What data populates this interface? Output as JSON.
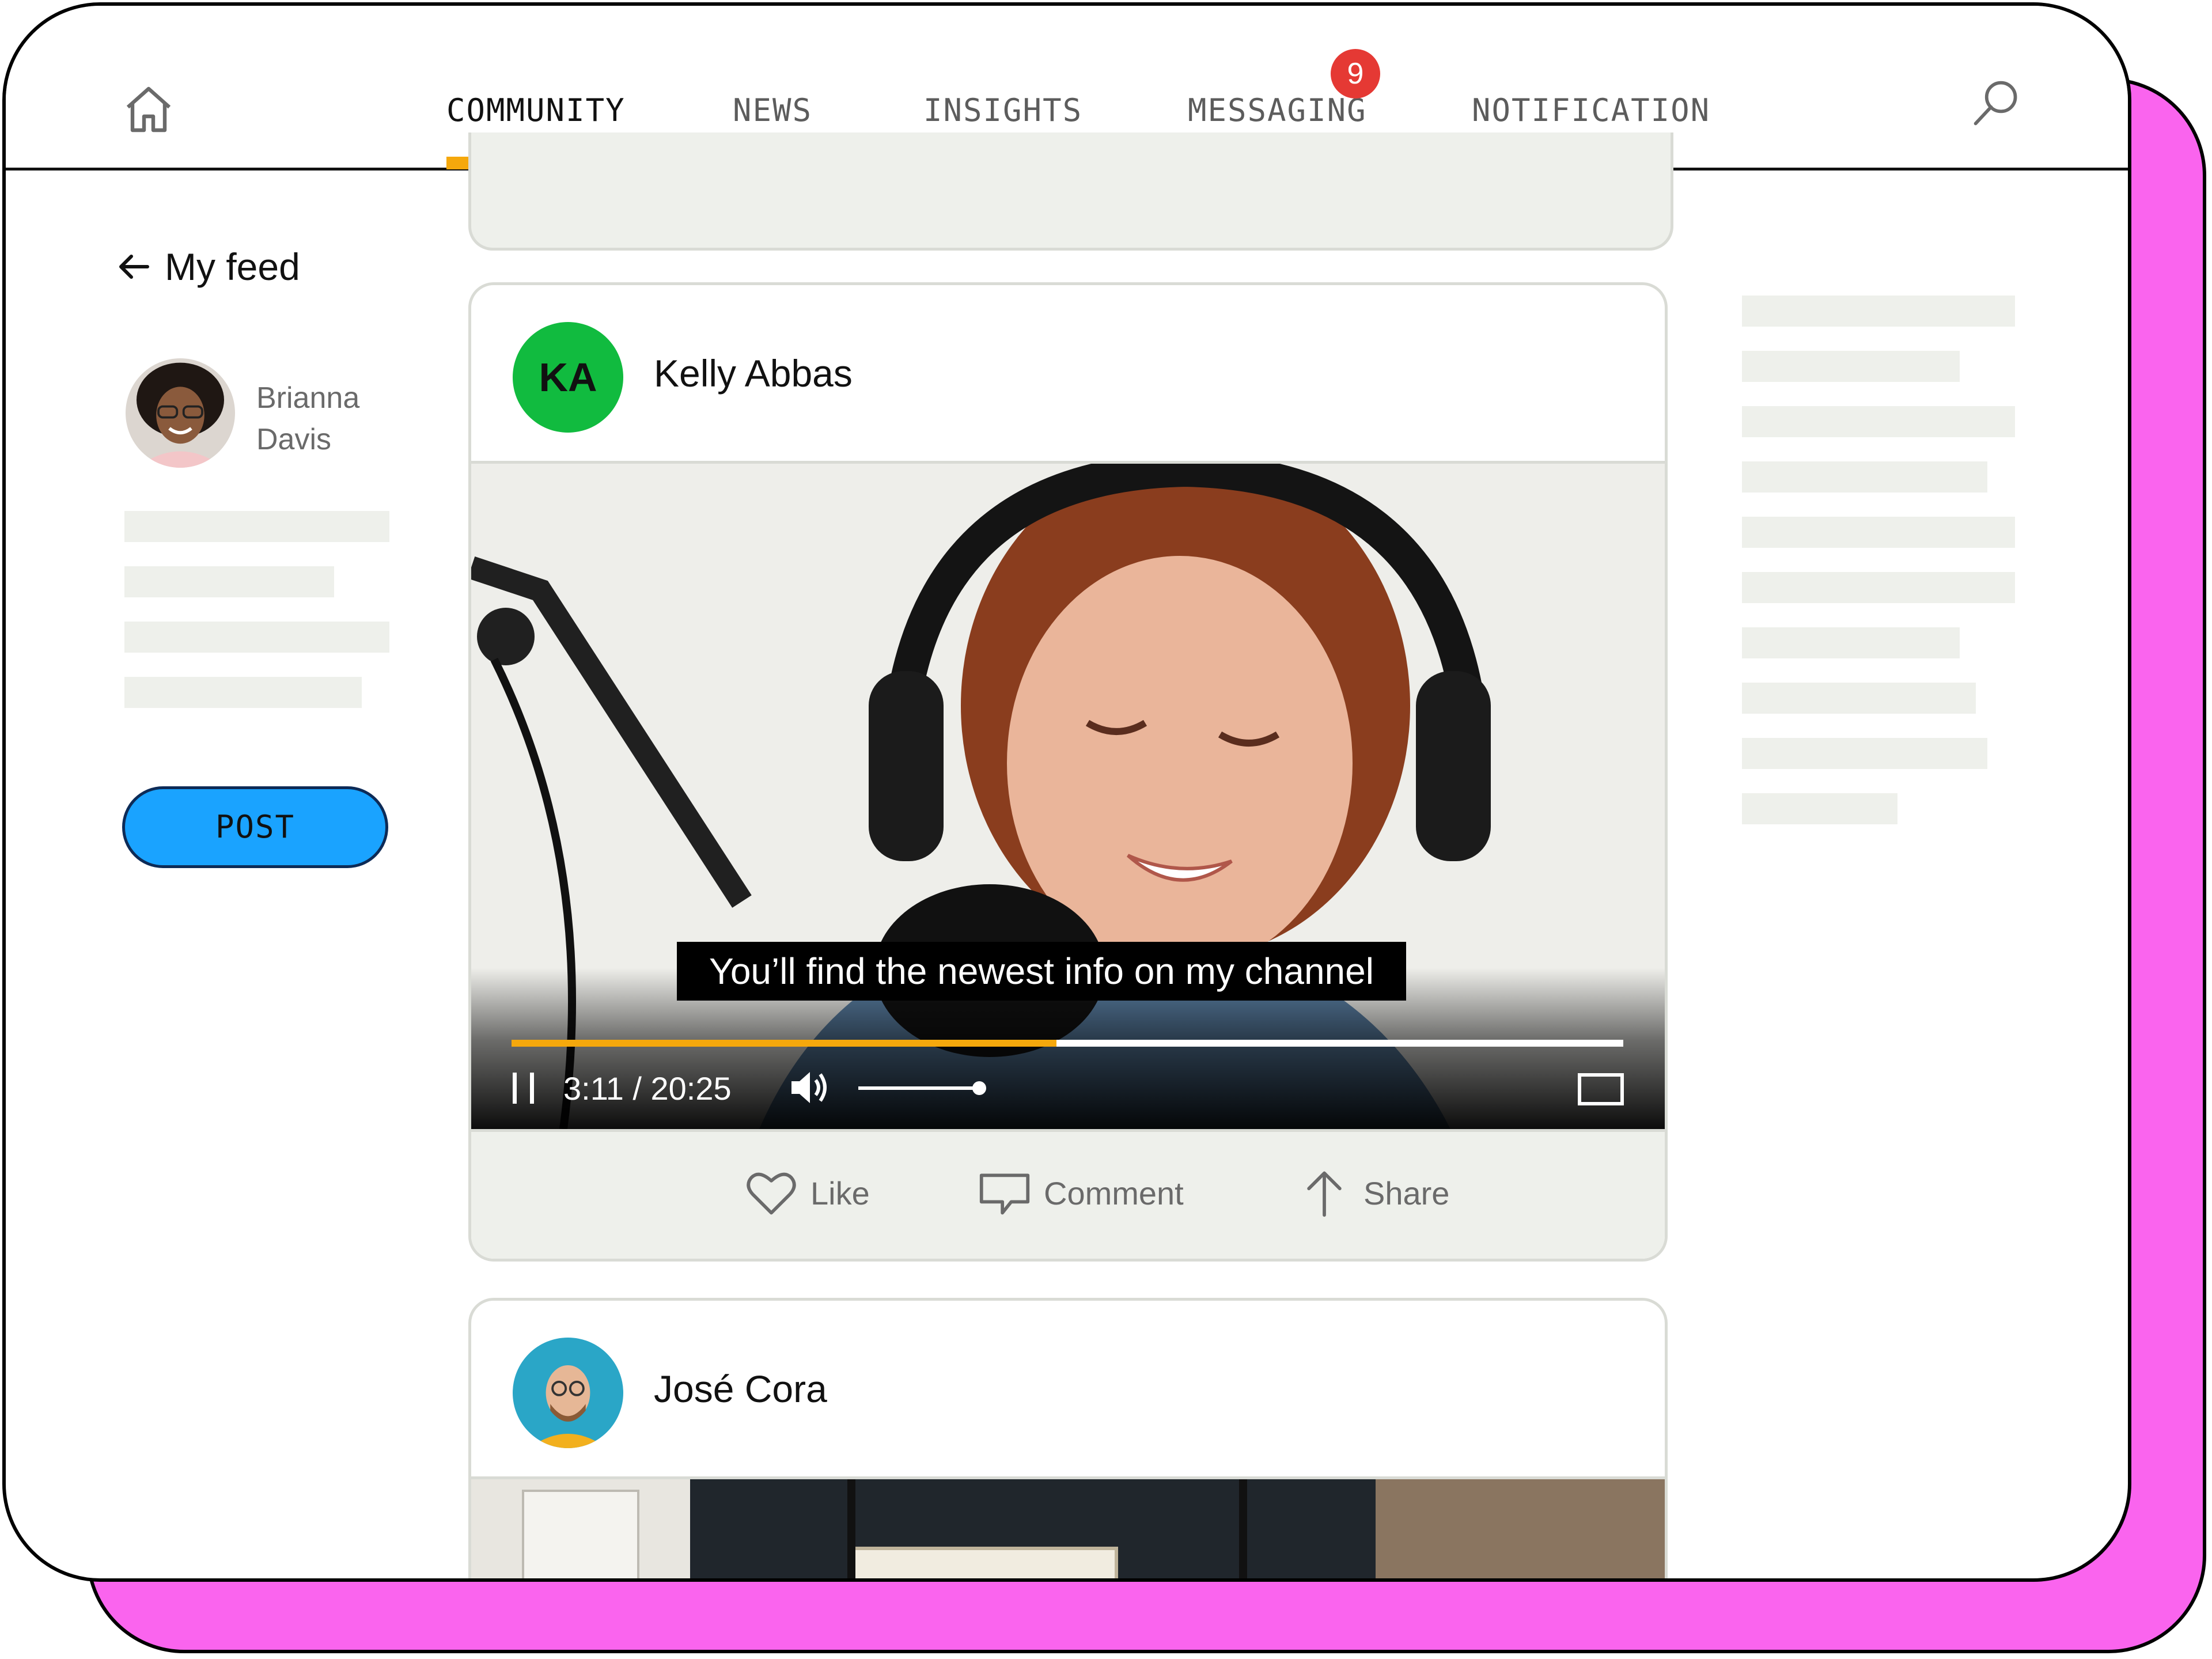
{
  "nav": {
    "tabs": [
      {
        "label": "COMMUNITY",
        "active": true
      },
      {
        "label": "NEWS",
        "active": false
      },
      {
        "label": "INSIGHTS",
        "active": false
      },
      {
        "label": "MESSAGING",
        "active": false
      },
      {
        "label": "NOTIFICATION",
        "active": false
      }
    ],
    "messaging_badge": "9",
    "home_icon": "home-icon",
    "search_icon": "search-icon",
    "accent_color": "#f5a80c"
  },
  "sidebar": {
    "back_label": "My feed",
    "user": {
      "first": "Brianna",
      "last": "Davis"
    },
    "post_button": "POST"
  },
  "feed": {
    "post1": {
      "author_initials": "KA",
      "author_name": "Kelly Abbas",
      "avatar_color": "#11bb3f",
      "video": {
        "caption": "You’ll find the newest info on my channel",
        "time": "3:11 / 20:25",
        "progress": 0.49,
        "volume": 0.9
      },
      "actions": {
        "like": "Like",
        "comment": "Comment",
        "share": "Share"
      }
    },
    "post2": {
      "author_name": "José Cora"
    }
  },
  "colors": {
    "frame_pink": "#fa64ee",
    "post_button_blue": "#1aa3ff",
    "badge_red": "#e53934",
    "skeleton": "#eef0eb"
  }
}
